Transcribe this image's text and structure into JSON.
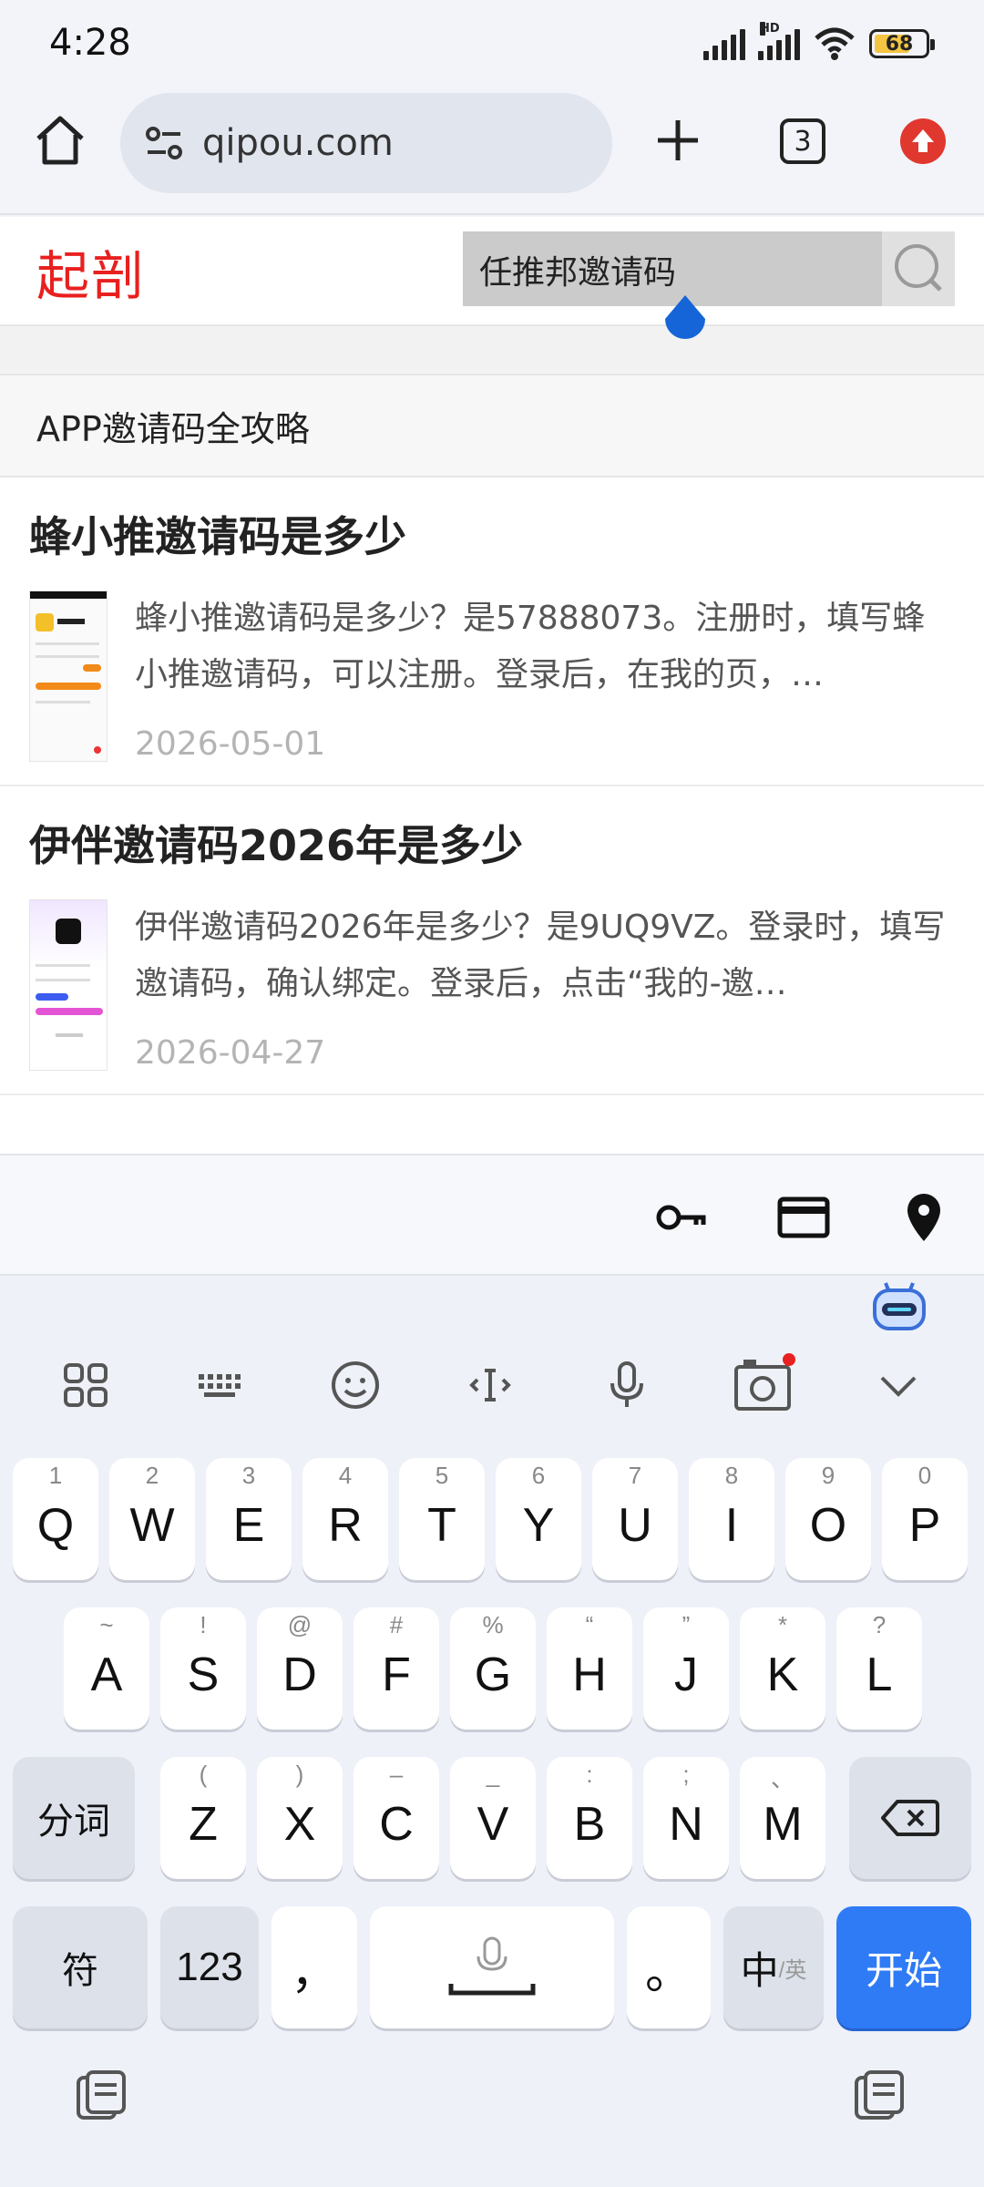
{
  "status_bar": {
    "time": "4:28",
    "network_label": "HD",
    "battery_level": "68"
  },
  "browser": {
    "url": "qipou.com",
    "tab_count": "3"
  },
  "page": {
    "logo": "起剖",
    "search_value": "任推邦邀请码",
    "category": "APP邀请码全攻略",
    "articles": [
      {
        "title": "蜂小推邀请码是多少",
        "excerpt": "蜂小推邀请码是多少？是57888073。注册时，填写蜂小推邀请码，可以注册。登录后，在我的页，…",
        "date": "2026-05-01"
      },
      {
        "title": "伊伴邀请码2026年是多少",
        "excerpt": "伊伴邀请码2026年是多少？是9UQ9VZ。登录时，填写邀请码，确认绑定。登录后，点击“我的-邀…",
        "date": "2026-04-27"
      }
    ]
  },
  "keyboard": {
    "row1": [
      {
        "hint": "1",
        "label": "Q"
      },
      {
        "hint": "2",
        "label": "W"
      },
      {
        "hint": "3",
        "label": "E"
      },
      {
        "hint": "4",
        "label": "R"
      },
      {
        "hint": "5",
        "label": "T"
      },
      {
        "hint": "6",
        "label": "Y"
      },
      {
        "hint": "7",
        "label": "U"
      },
      {
        "hint": "8",
        "label": "I"
      },
      {
        "hint": "9",
        "label": "O"
      },
      {
        "hint": "0",
        "label": "P"
      }
    ],
    "row2": [
      {
        "hint": "~",
        "label": "A"
      },
      {
        "hint": "!",
        "label": "S"
      },
      {
        "hint": "@",
        "label": "D"
      },
      {
        "hint": "#",
        "label": "F"
      },
      {
        "hint": "%",
        "label": "G"
      },
      {
        "hint": "“",
        "label": "H"
      },
      {
        "hint": "”",
        "label": "J"
      },
      {
        "hint": "*",
        "label": "K"
      },
      {
        "hint": "?",
        "label": "L"
      }
    ],
    "row3": [
      {
        "hint": "(",
        "label": "Z"
      },
      {
        "hint": ")",
        "label": "X"
      },
      {
        "hint": "–",
        "label": "C"
      },
      {
        "hint": "_",
        "label": "V"
      },
      {
        "hint": ":",
        "label": "B"
      },
      {
        "hint": ";",
        "label": "N"
      },
      {
        "hint": "、",
        "label": "M"
      }
    ],
    "segment_label": "分词",
    "symbols_label": "符",
    "numbers_label": "123",
    "comma_label": "，",
    "period_label": "。",
    "lang_main": "中",
    "lang_alt": "/英",
    "go_label": "开始"
  }
}
